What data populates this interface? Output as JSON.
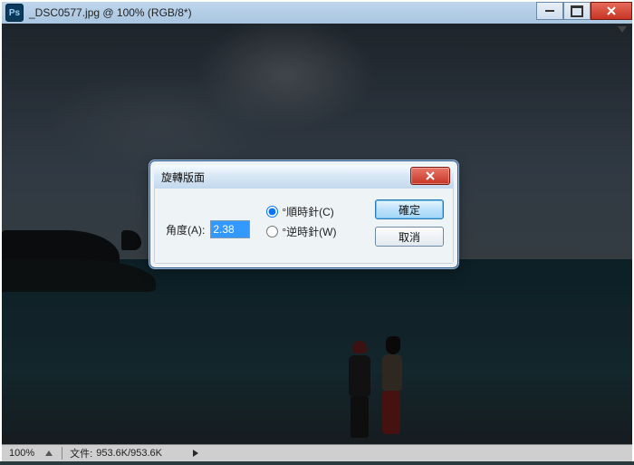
{
  "window": {
    "title": "_DSC0577.jpg @ 100% (RGB/8*)"
  },
  "statusbar": {
    "zoom": "100%",
    "file_label": "文件:",
    "file_value": "953.6K/953.6K"
  },
  "dialog": {
    "title": "旋轉版面",
    "angle_label": "角度(A):",
    "angle_value": "2.38",
    "cw_label": "°順時針(C)",
    "ccw_label": "°逆時針(W)",
    "ok": "確定",
    "cancel": "取消",
    "direction": "cw"
  }
}
